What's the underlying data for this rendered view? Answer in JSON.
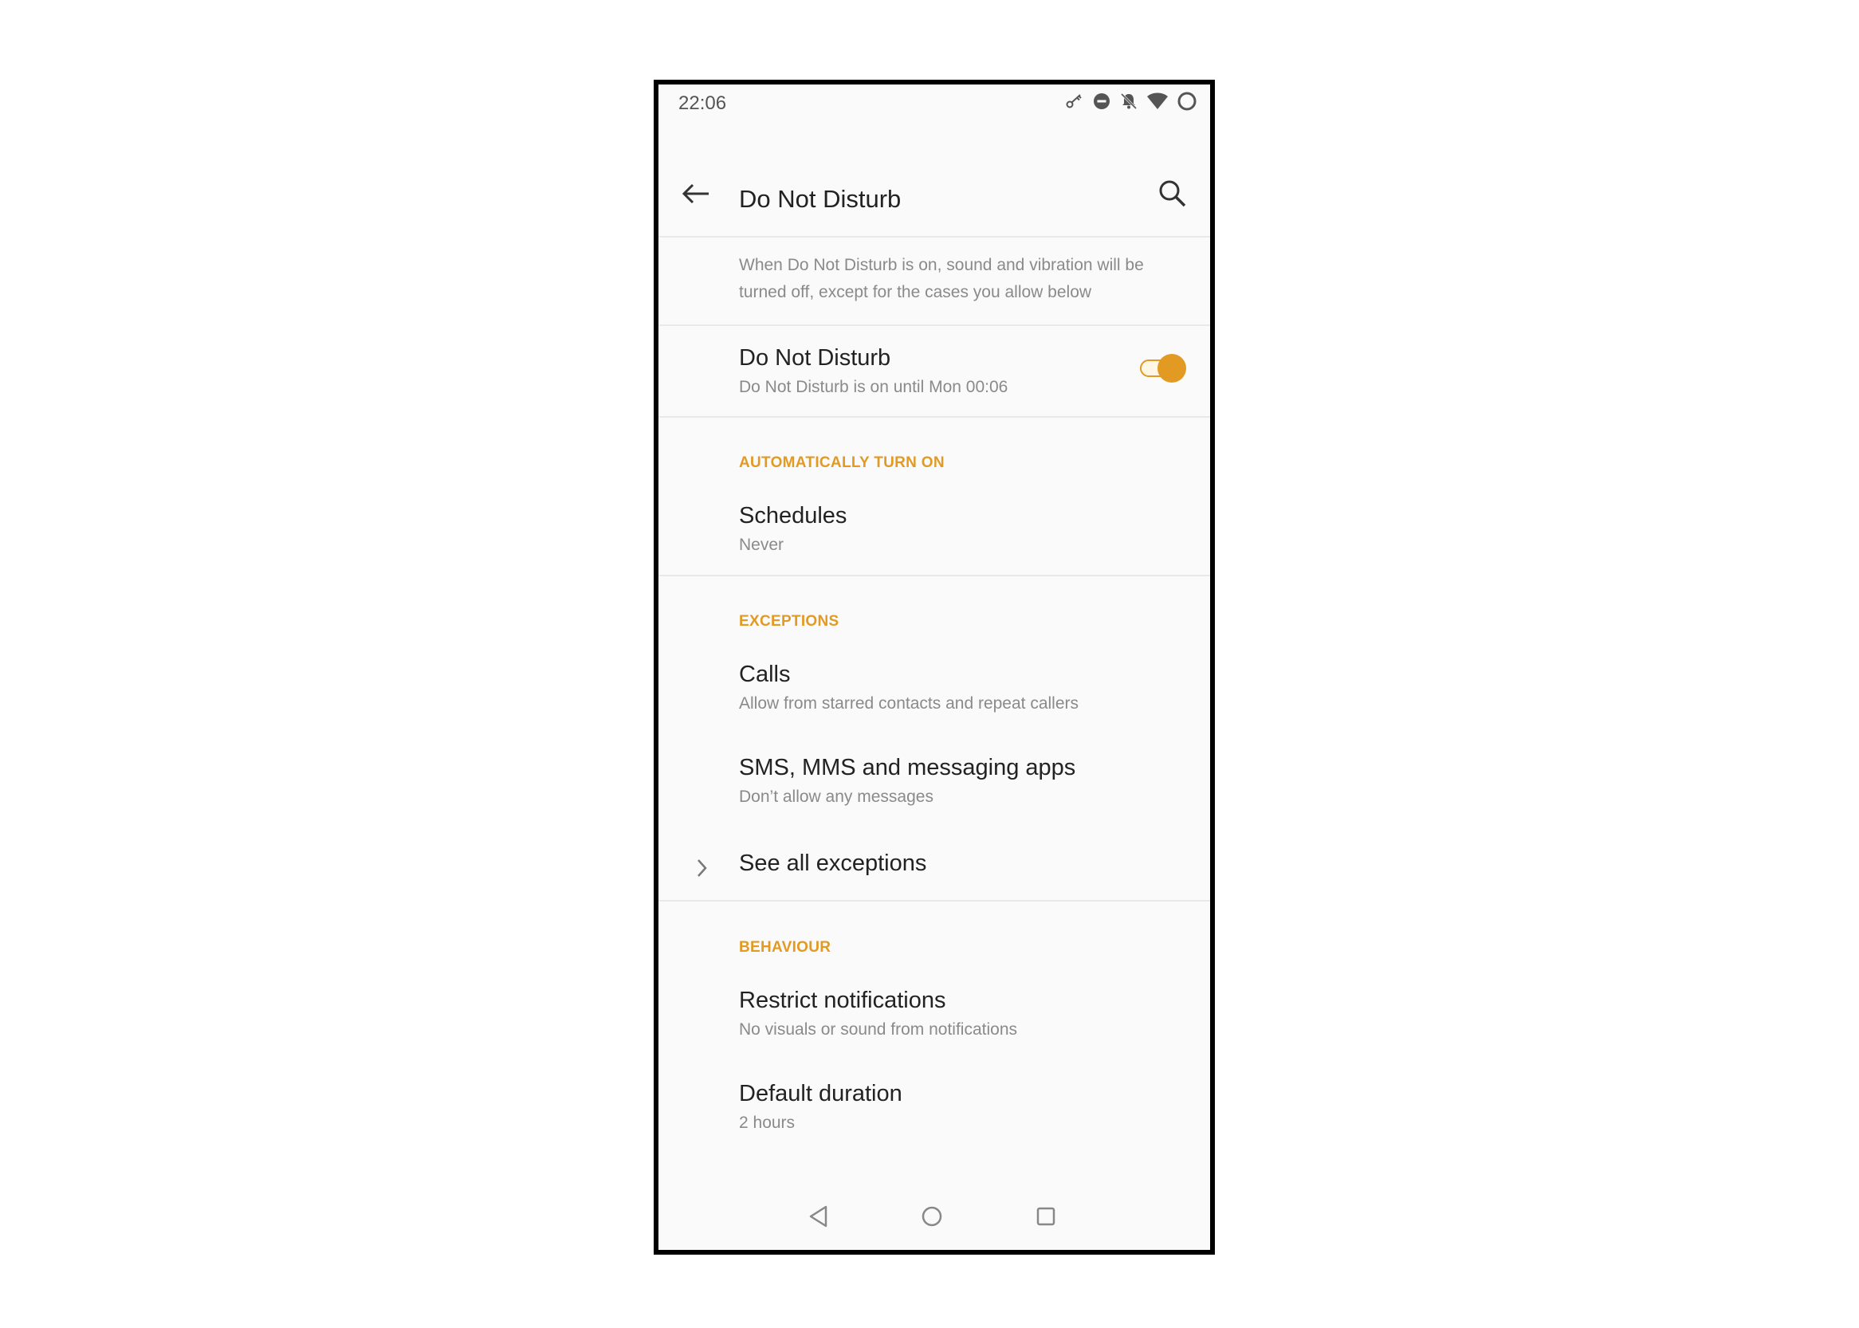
{
  "status_bar": {
    "time": "22:06",
    "icons": [
      "vpn-key-icon",
      "dnd-minus-icon",
      "bell-off-icon",
      "wifi-icon",
      "battery-ring-icon"
    ]
  },
  "app_bar": {
    "title": "Do Not Disturb",
    "back_icon": "arrow-left-icon",
    "search_icon": "search-icon"
  },
  "intro_text": "When Do Not Disturb is on, sound and vibration will be turned off, except for the cases you allow below",
  "dnd_toggle": {
    "title": "Do Not Disturb",
    "subtitle": "Do Not Disturb is on until Mon 00:06",
    "state": "on"
  },
  "sections": {
    "auto": {
      "header": "AUTOMATICALLY TURN ON",
      "schedules": {
        "title": "Schedules",
        "subtitle": "Never"
      }
    },
    "exceptions": {
      "header": "EXCEPTIONS",
      "calls": {
        "title": "Calls",
        "subtitle": "Allow from starred contacts and repeat callers"
      },
      "messages": {
        "title": "SMS, MMS and messaging apps",
        "subtitle": "Don’t allow any messages"
      },
      "see_all": {
        "title": "See all exceptions"
      }
    },
    "behaviour": {
      "header": "BEHAVIOUR",
      "restrict": {
        "title": "Restrict notifications",
        "subtitle": "No visuals or sound from notifications"
      },
      "duration": {
        "title": "Default duration",
        "subtitle": "2 hours"
      }
    }
  },
  "colors": {
    "accent": "#e29a23",
    "text_primary": "#222222",
    "text_secondary": "#8a8a8a",
    "background": "#fafafa"
  },
  "nav_bar": {
    "buttons": [
      "nav-back-icon",
      "nav-home-icon",
      "nav-recents-icon"
    ]
  }
}
